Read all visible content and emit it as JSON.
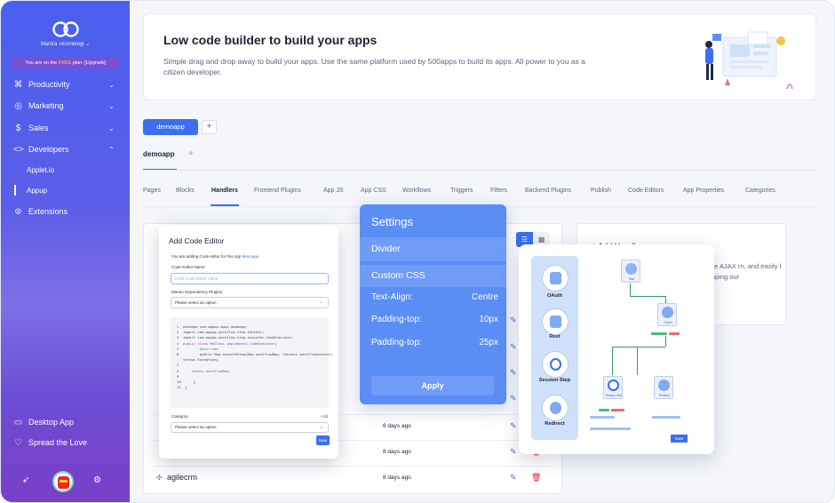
{
  "sidebar": {
    "org_name": "Mantra Technologi",
    "plan_prefix": "You are on the ",
    "plan_free": "FREE",
    "plan_suffix": " plan. [Upgrade]",
    "items": [
      {
        "label": "Productivity",
        "icon": "command-icon"
      },
      {
        "label": "Marketing",
        "icon": "target-icon"
      },
      {
        "label": "Sales",
        "icon": "dollar-icon"
      },
      {
        "label": "Developers",
        "icon": "code-icon"
      },
      {
        "label": "Extensions",
        "icon": "extensions-icon"
      }
    ],
    "sub_items": [
      {
        "label": "Applet.io"
      },
      {
        "label": "Appup"
      }
    ],
    "bottom_items": [
      {
        "label": "Desktop App",
        "icon": "monitor-icon"
      },
      {
        "label": "Spread the Love",
        "icon": "heart-icon"
      }
    ]
  },
  "banner": {
    "title": "Low code builder to build your apps",
    "description": "Simple drag and drop away to build your apps. Use the same platform used by 500apps to build its apps. All power to you as a citizen developer."
  },
  "app_tabs": {
    "active": "demoapp",
    "plus": "+"
  },
  "app_title": "demoapp",
  "sub_tabs": [
    "Pages",
    "Blocks",
    "Handlers",
    "Frontend Plugins",
    "App JS",
    "App CSS",
    "Workflows",
    "Triggers",
    "Filters",
    "Backend Plugins",
    "Publish",
    "Code Editors",
    "App Properties",
    "Categories"
  ],
  "active_sub_tab": "Handlers",
  "right_panel": {
    "title": "+ Add Handler",
    "text": "those AJAX rn, and easily l dropping our"
  },
  "rows": [
    {
      "when": "6 days ago"
    },
    {
      "when": "8 days ago"
    },
    {
      "name": "agilecrm",
      "when": "8 days ago"
    }
  ],
  "code_editor": {
    "title": "Add Code Editor",
    "intro": "You are adding Code editor for this App ",
    "intro_link": "demoapp",
    "name_label": "Code Editor Name",
    "name_placeholder": "Enter Code Editor name",
    "maven_label": "Maven Dependency Plugins",
    "maven_value": "Please select an option",
    "code_lines": [
      "1  package com.appup.apps.demoapp;",
      "2  import com.appup.workflow.step.Context;",
      "3  import com.appup.workflow.step.executor.CodeExecutor;",
      "4  public class MyClass implements CodeExecutor{",
      "5          @Override",
      "6          public Map executeStep(Map workflowMap, Context workflowContext)",
      "   throws Exception{",
      "7",
      "8      return workflowMap;",
      "9",
      "10      }",
      "11  }"
    ],
    "category_label": "Category",
    "add_label": "Add",
    "category_value": "Please select an option",
    "save_label": "Save"
  },
  "settings": {
    "title": "Settings",
    "divider": "Divider",
    "custom_css": "Custom CSS",
    "props": [
      {
        "label": "Text-Align:",
        "value": "Centre"
      },
      {
        "label": "Padding-top:",
        "value": "10px"
      },
      {
        "label": "Padding-top:",
        "value": "25px"
      }
    ],
    "apply": "Apply"
  },
  "workflow": {
    "palette": [
      {
        "label": "OAuth"
      },
      {
        "label": "Rest"
      },
      {
        "label": "Session Step"
      },
      {
        "label": "Redirect"
      }
    ],
    "node_captions": [
      "Start",
      "OAuth",
      "Session Step",
      "Redirect"
    ],
    "save": "Save"
  },
  "colors": {
    "accent": "#3b6ef0",
    "settings_bg": "#5b8ef5",
    "danger": "#ee2233"
  }
}
